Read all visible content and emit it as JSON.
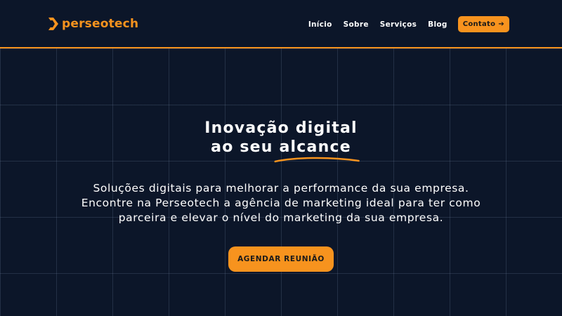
{
  "brand": {
    "name": "perseotech",
    "accent_color": "#f7931e",
    "background_color": "#0c1629",
    "logo_icon": "chevron-logo-icon"
  },
  "nav": {
    "items": [
      {
        "label": "Início"
      },
      {
        "label": "Sobre"
      },
      {
        "label": "Serviços"
      },
      {
        "label": "Blog"
      }
    ],
    "cta_label": "Contato",
    "cta_icon": "arrow-right-icon"
  },
  "hero": {
    "title_line1": "Inovação digital",
    "title_line2_prefix": "ao seu ",
    "title_highlight": "alcance",
    "subtitle_lines": [
      "Soluções digitais para melhorar a performance da sua empresa.",
      "Encontre na Perseotech a agência de marketing ideal para ter como",
      "parceira e elevar o nível do marketing da sua empresa."
    ],
    "cta_label": "AGENDAR REUNIÃO"
  }
}
